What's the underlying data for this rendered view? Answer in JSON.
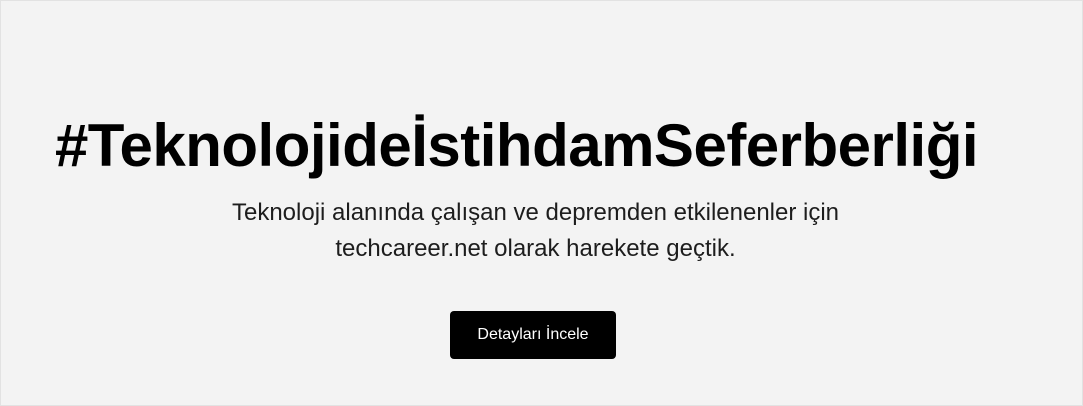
{
  "hero": {
    "title": "#TeknolojideİstihdamSeferberliği",
    "subtitle_line1": "Teknoloji alanında çalışan ve depremden etkilenenler için",
    "subtitle_line2": "techcareer.net olarak harekete geçtik.",
    "cta_label": "Detayları İncele"
  },
  "colors": {
    "background": "#f3f3f3",
    "title": "#000000",
    "button_bg": "#000000",
    "button_text": "#ffffff"
  }
}
